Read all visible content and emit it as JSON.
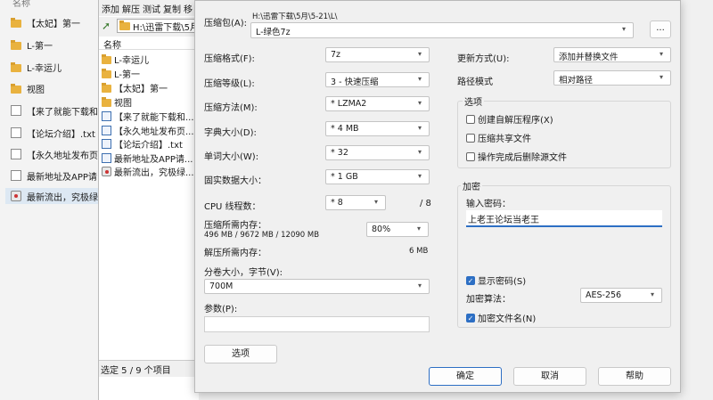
{
  "explorer": {
    "header": "名称",
    "items": [
      {
        "label": "【太妃】第一",
        "icon": "folder-icon"
      },
      {
        "label": "L-第一",
        "icon": "folder-icon"
      },
      {
        "label": "L-幸运儿",
        "icon": "folder-icon"
      },
      {
        "label": "视图",
        "icon": "folder-icon"
      },
      {
        "label": "【来了就能下载和",
        "icon": "document-icon"
      },
      {
        "label": "【论坛介绍】.txt",
        "icon": "document-icon"
      },
      {
        "label": "【永久地址发布页】",
        "icon": "document-icon"
      },
      {
        "label": "最新地址及APP请",
        "icon": "document-icon"
      },
      {
        "label": "最新流出，究极绿",
        "icon": "app-icon"
      }
    ]
  },
  "filemanager": {
    "menu": [
      "添加",
      "解压",
      "测试",
      "复制",
      "移"
    ],
    "path": "H:\\迅雷下载\\5月",
    "column_name": "名称",
    "items": [
      {
        "label": "L-幸运儿",
        "icon": "folder-icon"
      },
      {
        "label": "L-第一",
        "icon": "folder-icon"
      },
      {
        "label": "【太妃】第一",
        "icon": "folder-icon"
      },
      {
        "label": "视图",
        "icon": "folder-icon"
      },
      {
        "label": "【来了就能下载和...",
        "icon": "document-icon"
      },
      {
        "label": "【永久地址发布页...",
        "icon": "document-icon"
      },
      {
        "label": "【论坛介绍】.txt",
        "icon": "document-icon"
      },
      {
        "label": "最新地址及APP请...",
        "icon": "document-icon"
      },
      {
        "label": "最新流出，究极绿...",
        "icon": "app-icon"
      }
    ],
    "status": "选定 5 / 9 个项目"
  },
  "dialog": {
    "archive_label": "压缩包(A):",
    "archive_dir": "H:\\迅雷下载\\5月\\5-21\\L\\",
    "archive_name": "L-绿色7z",
    "browse": "...",
    "format_label": "压缩格式(F):",
    "format_value": "7z",
    "level_label": "压缩等级(L):",
    "level_value": "3 - 快速压缩",
    "method_label": "压缩方法(M):",
    "method_value": "* LZMA2",
    "dict_label": "字典大小(D):",
    "dict_value": "* 4 MB",
    "word_label": "单词大小(W):",
    "word_value": "* 32",
    "solid_label": "固实数据大小：",
    "solid_value": "* 1 GB",
    "cpu_label": "CPU 线程数：",
    "cpu_value": "* 8",
    "cpu_max": "/ 8",
    "mem_label": "压缩所需内存：",
    "mem_detail": "496 MB / 9672 MB / 12090 MB",
    "mem_percent": "80%",
    "decomp_label": "解压所需内存：",
    "decomp_value": "6 MB",
    "volume_label": "分卷大小，字节(V):",
    "volume_value": "700M",
    "params_label": "参数(P):",
    "options_btn": "选项",
    "update_label": "更新方式(U):",
    "update_value": "添加并替换文件",
    "path_label": "路径模式",
    "path_value": "相对路径",
    "options_group": "选项",
    "opt_sfx": "创建自解压程序(X)",
    "opt_shared": "压缩共享文件",
    "opt_delete": "操作完成后删除源文件",
    "encrypt_group": "加密",
    "password_label": "输入密码：",
    "password_value": "上老王论坛当老王",
    "show_password": "显示密码(S)",
    "enc_method_label": "加密算法：",
    "enc_method_value": "AES-256",
    "encrypt_names": "加密文件名(N)",
    "ok": "确定",
    "cancel": "取消",
    "help": "帮助"
  },
  "colors": {
    "accent": "#2d6fc4",
    "folder": "#e9b23f",
    "selection": "#dde8f3"
  }
}
